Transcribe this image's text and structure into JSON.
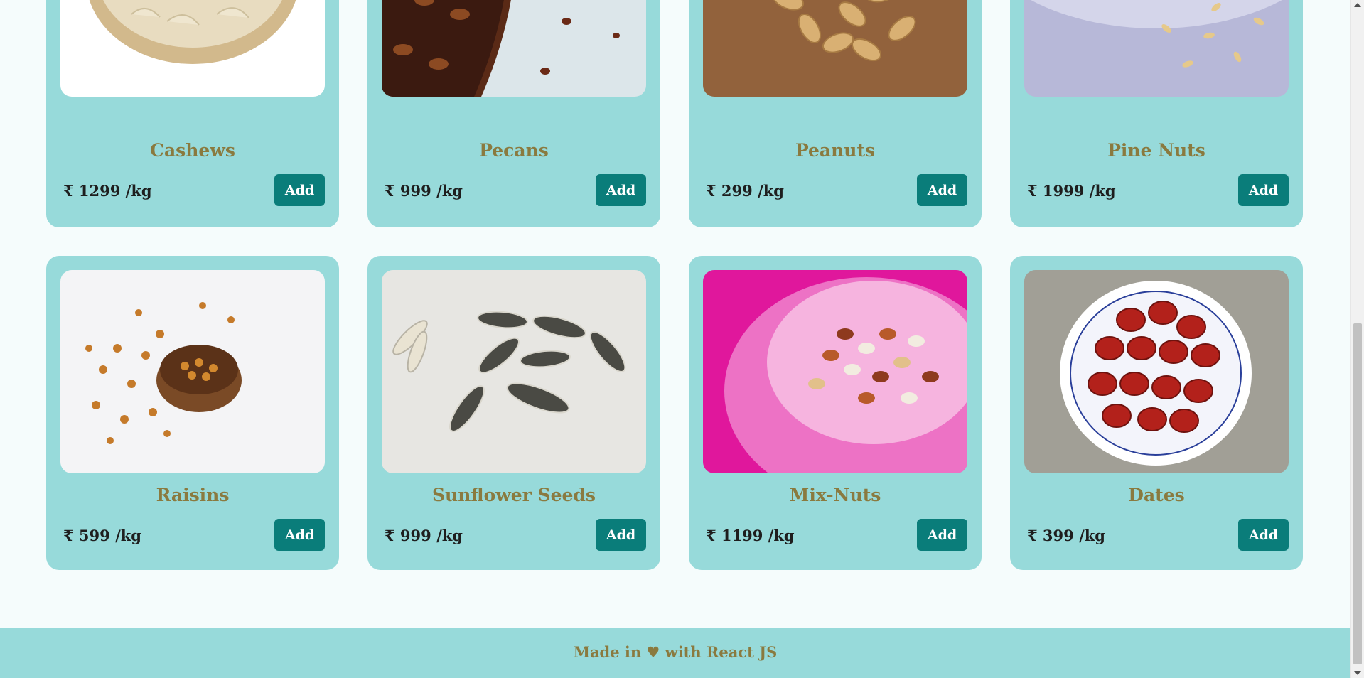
{
  "products": [
    {
      "name": "Cashews",
      "price": "₹ 1299 /kg",
      "button": "Add"
    },
    {
      "name": "Pecans",
      "price": "₹ 999 /kg",
      "button": "Add"
    },
    {
      "name": "Peanuts",
      "price": "₹ 299 /kg",
      "button": "Add"
    },
    {
      "name": "Pine Nuts",
      "price": "₹ 1999 /kg",
      "button": "Add"
    },
    {
      "name": "Raisins",
      "price": "₹ 599 /kg",
      "button": "Add"
    },
    {
      "name": "Sunflower Seeds",
      "price": "₹ 999 /kg",
      "button": "Add"
    },
    {
      "name": "Mix-Nuts",
      "price": "₹ 1199 /kg",
      "button": "Add"
    },
    {
      "name": "Dates",
      "price": "₹ 399 /kg",
      "button": "Add"
    }
  ],
  "footer": {
    "made_in": "Made in",
    "heart": "♥",
    "with_text": "with React JS"
  },
  "colors": {
    "card_bg": "#97dada",
    "button_bg": "#0a7d7a",
    "title_color": "#8a7a3f",
    "page_bg": "#f5fcfc"
  }
}
